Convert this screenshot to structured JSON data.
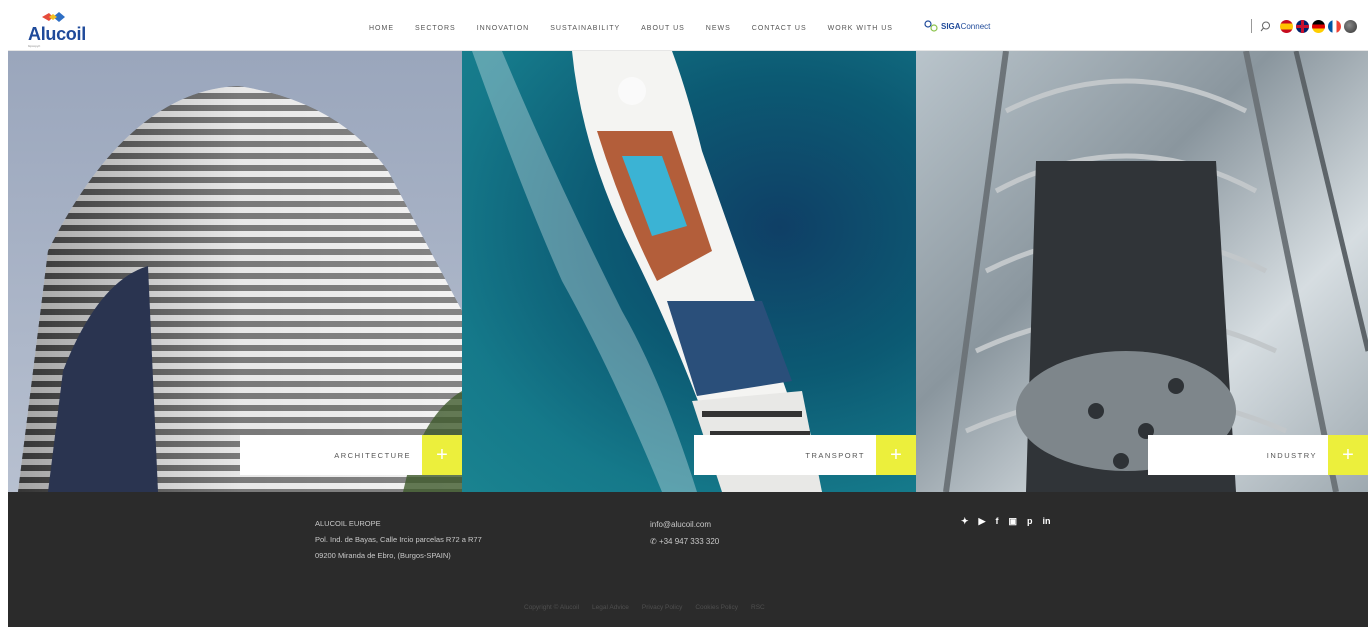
{
  "header": {
    "logo": {
      "name": "Alucoil",
      "tagline": "bipcopyrt"
    },
    "nav": [
      "HOME",
      "SECTORS",
      "INNOVATION",
      "SUSTAINABILITY",
      "ABOUT US",
      "NEWS",
      "CONTACT US",
      "WORK WITH US"
    ],
    "siga": {
      "bold": "SIGA",
      "light": "Connect"
    },
    "icons": [
      "search-icon"
    ],
    "languages": [
      "spanish-flag-icon",
      "english-flag-icon",
      "german-flag-icon",
      "french-flag-icon",
      "world-globe-icon"
    ]
  },
  "panels": [
    {
      "label": "ARCHITECTURE",
      "plus": "+"
    },
    {
      "label": "TRANSPORT",
      "plus": "+"
    },
    {
      "label": "INDUSTRY",
      "plus": "+"
    }
  ],
  "footer": {
    "address": {
      "line1": "ALUCOIL EUROPE",
      "line2": "Pol. Ind. de Bayas, Calle Ircio parcelas R72 a R77",
      "line3": "09200 Miranda de Ebro, (Burgos-SPAIN)"
    },
    "email": "info@alucoil.com",
    "phone": "+34 947 333 320",
    "social_icons": [
      "twitter-icon",
      "youtube-icon",
      "facebook-icon",
      "issuu-icon",
      "pinterest-icon",
      "linkedin-icon"
    ],
    "legal": [
      "Copyright © Alucoil",
      "Legal Advice",
      "Privacy Policy",
      "Cookies Policy",
      "RSC"
    ]
  },
  "colors": {
    "accent": "#ecef3c",
    "brand": "#1f4a9a",
    "footer": "#2b2b2b"
  }
}
